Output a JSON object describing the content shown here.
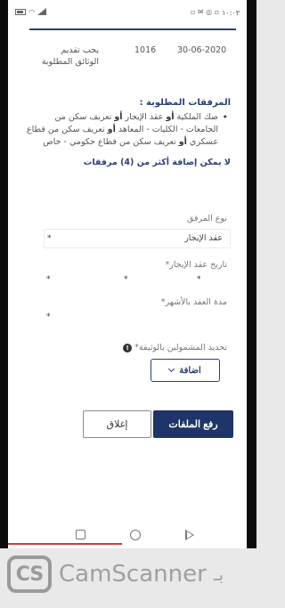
{
  "status_bar": {
    "time": "١٠:٠٣",
    "icons": [
      "signal-icon",
      "wifi-icon",
      "battery-icon",
      "notification-icons"
    ]
  },
  "request": {
    "status": "يجب تقديم الوثائق المطلوبة",
    "number": "1016",
    "date": "30-06-2020"
  },
  "attachments": {
    "title": "المرفقات المطلوبة :",
    "line1_a": "صك الملكية ",
    "line1_or1": "أو",
    "line1_b": " عقد الإيجار ",
    "line1_or2": "أو",
    "line1_c": " تعريف سكن من الجامعات - الكليات - المعاهد ",
    "line1_or3": "أو",
    "line1_d": " تعريف سكن من قطاع عسكري ",
    "line1_or4": "أو",
    "line1_e": " تعريف سكن من قطاع حكومي - خاص",
    "limit": "لا يمكن إضافة أكثر من (4) مرفقات"
  },
  "form": {
    "type_label": "نوع المرفق",
    "type_value": "عقد الإيجار",
    "date_label": "تاريخ عقد الإيجار",
    "duration_label": "مدة العقد بالأشهر",
    "docs_label": "تحديد المشمولين بالوثيقة",
    "required_mark": "*",
    "info_icon": "!",
    "add_label": "اضافة"
  },
  "actions": {
    "upload_label": "رفع الملفات",
    "close_label": "إغلاق"
  },
  "watermark": {
    "logo": "CS",
    "text": "CamScanner",
    "by": "بـ"
  }
}
